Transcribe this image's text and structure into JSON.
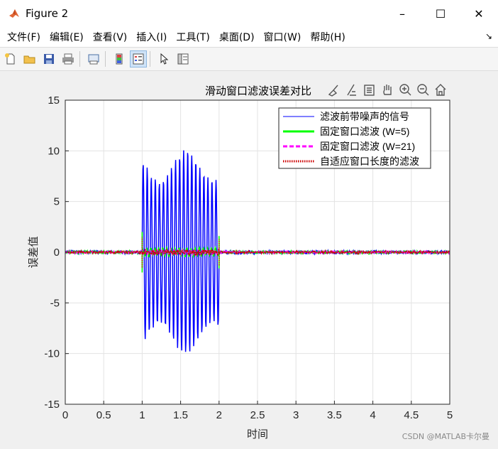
{
  "window": {
    "title": "Figure 2",
    "app_icon": "matlab-icon"
  },
  "window_controls": {
    "minimize": "–",
    "maximize": "☐",
    "close": "✕"
  },
  "menu": [
    {
      "label": "文件(F)",
      "name": "menu-file"
    },
    {
      "label": "编辑(E)",
      "name": "menu-edit"
    },
    {
      "label": "查看(V)",
      "name": "menu-view"
    },
    {
      "label": "插入(I)",
      "name": "menu-insert"
    },
    {
      "label": "工具(T)",
      "name": "menu-tools"
    },
    {
      "label": "桌面(D)",
      "name": "menu-desktop"
    },
    {
      "label": "窗口(W)",
      "name": "menu-window"
    },
    {
      "label": "帮助(H)",
      "name": "menu-help"
    }
  ],
  "toolbar_icons": [
    "new-figure-icon",
    "open-folder-icon",
    "save-icon",
    "print-icon",
    "print-preview-icon",
    "colorbar-icon",
    "legend-icon",
    "pointer-icon",
    "property-inspector-icon"
  ],
  "axes_toolbar_icons": [
    "brush-icon",
    "data-tips-icon",
    "edit-axes-icon",
    "pan-icon",
    "zoom-in-icon",
    "zoom-out-icon",
    "home-icon"
  ],
  "watermark": "CSDN @MATLAB卡尔曼",
  "chart_data": {
    "type": "line",
    "title": "滑动窗口滤波误差对比",
    "xlabel": "时间",
    "ylabel": "误差值",
    "xlim": [
      0,
      5
    ],
    "ylim": [
      -15,
      15
    ],
    "xticks": [
      "0",
      "0.5",
      "1",
      "1.5",
      "2",
      "2.5",
      "3",
      "3.5",
      "4",
      "4.5",
      "5"
    ],
    "yticks": [
      "15",
      "10",
      "5",
      "0",
      "-5",
      "-10",
      "-15"
    ],
    "grid": true,
    "legend_position": "top-right",
    "legend": [
      {
        "label": "滤波前带噪声的信号",
        "color": "#0000ff",
        "style": "solid"
      },
      {
        "label": "固定窗口滤波 (W=5)",
        "color": "#00ff00",
        "style": "solid"
      },
      {
        "label": "固定窗口滤波 (W=21)",
        "color": "#ff00ff",
        "style": "dashed"
      },
      {
        "label": "自适应窗口长度的滤波",
        "color": "#cc0000",
        "style": "dotted"
      }
    ],
    "series_colors": {
      "noisy": "#0000ff",
      "w5": "#00ff00",
      "w21": "#ff00ff",
      "adaptive": "#cc0000"
    },
    "burst": {
      "x_start": 1.0,
      "x_end": 2.0,
      "amplitude": 10,
      "noise_level": 0.1
    }
  }
}
